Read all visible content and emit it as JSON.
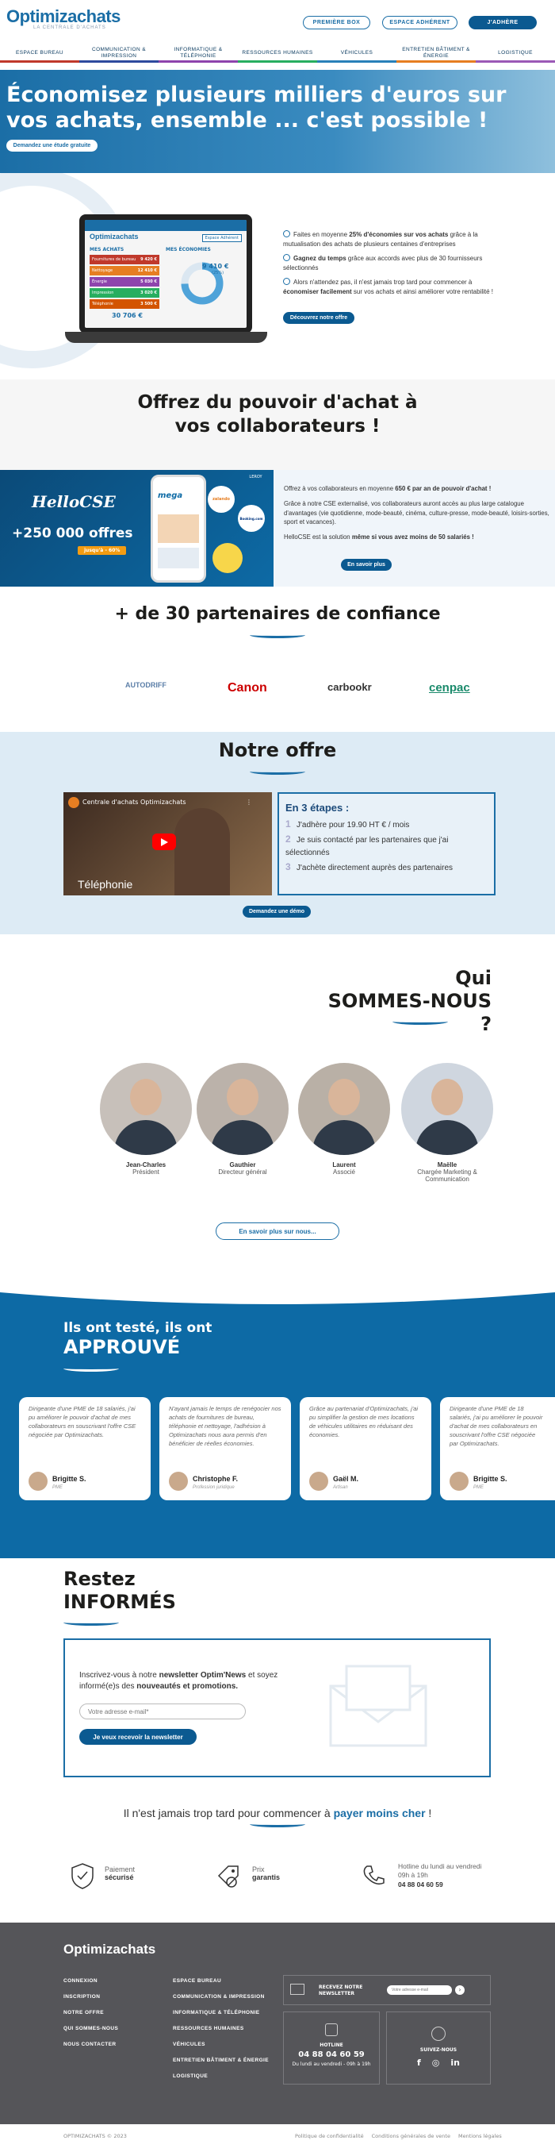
{
  "header": {
    "logo": "Optimizachats",
    "tagline": "LA CENTRALE D'ACHATS",
    "btn_demo": "PREMIÈRE BOX",
    "btn_login": "ESPACE ADHÉRENT",
    "btn_join": "J'ADHÈRE",
    "nav": [
      {
        "label": "ESPACE BUREAU",
        "color": "#c0392b"
      },
      {
        "label": "COMMUNICATION & IMPRESSION",
        "color": "#2e4a9e"
      },
      {
        "label": "INFORMATIQUE & TÉLÉPHONIE",
        "color": "#8e44ad"
      },
      {
        "label": "RESSOURCES HUMAINES",
        "color": "#27ae60"
      },
      {
        "label": "VÉHICULES",
        "color": "#2980b9"
      },
      {
        "label": "ENTRETIEN BÂTIMENT & ÉNERGIE",
        "color": "#e67e22"
      },
      {
        "label": "LOGISTIQUE",
        "color": "#9b59b6"
      }
    ]
  },
  "hero": {
    "title": "Économisez plusieurs milliers d'euros sur vos achats, ensemble ... c'est possible !",
    "cta": "Demandez une étude gratuite"
  },
  "intro": {
    "screen_title": "Optimizachats",
    "screen_tag": "Espace Adhérent",
    "screen_left_title": "MES ACHATS",
    "screen_right_title": "MES ÉCONOMIES",
    "screen_rows": [
      {
        "label": "Fournitures de bureau",
        "value": "9 420 €",
        "color": "#c0392b"
      },
      {
        "label": "Nettoyage",
        "value": "12 410 €",
        "color": "#e67e22"
      },
      {
        "label": "Énergie",
        "value": "5 030 €",
        "color": "#8e44ad"
      },
      {
        "label": "Impression",
        "value": "3 020 €",
        "color": "#27ae60"
      },
      {
        "label": "Téléphonie",
        "value": "3 500 €",
        "color": "#d35400"
      }
    ],
    "screen_saving": "9 410 €",
    "screen_saving_pct": "(25%)",
    "screen_total": "30 706 €",
    "points": [
      {
        "pre": "Faites en moyenne ",
        "bold": "25% d'économies sur vos achats",
        "post": " grâce à la mutualisation des achats de plusieurs centaines d'entreprises"
      },
      {
        "pre": "",
        "bold": "Gagnez du temps",
        "post": " grâce aux accords avec plus de 30 fournisseurs sélectionnés"
      },
      {
        "pre": "Alors n'attendez pas, il n'est jamais trop tard pour commencer à ",
        "bold": "économiser facilement",
        "post": " sur vos achats et ainsi améliorer votre rentabilité !"
      }
    ],
    "cta": "Découvrez notre offre"
  },
  "cse": {
    "title": "Offrez du pouvoir d'achat à vos collaborateurs !",
    "brand": "HelloCSE",
    "big": "+250 000 offres",
    "promo": "jusqu'à - 60%",
    "p1_pre": "Offrez à vos collaborateurs en moyenne ",
    "p1_bold": "650 € par an de pouvoir d'achat !",
    "p2": "Grâce à notre CSE externalisé, vos collaborateurs auront accès au plus large catalogue d'avantages (vie quotidienne, mode-beauté, cinéma, culture-presse, mode-beauté, loisirs-sorties, sport et vacances).",
    "p3_pre": "HelloCSE est la solution ",
    "p3_bold": "même si vous avez moins de 50 salariés !",
    "cta": "En savoir plus",
    "phone_brand": "mega",
    "tag1": "LEROY",
    "tag2": "Booking.com",
    "tag3": "zalando"
  },
  "partners": {
    "title": "+ de 30 partenaires de confiance",
    "items": [
      {
        "name": "AUTODRIFF",
        "color": "#5c7fa8"
      },
      {
        "name": "Canon",
        "color": "#cc0000"
      },
      {
        "name": "carbookr",
        "color": "#333333"
      },
      {
        "name": "cenpac",
        "color": "#1a8a6b"
      }
    ]
  },
  "offer": {
    "title": "Notre offre",
    "video_title": "Centrale d'achats Optimizachats",
    "video_caption": "Téléphonie",
    "steps_title": "En 3 étapes :",
    "steps": [
      "J'adhère pour 19.90 HT € / mois",
      "Je suis contacté par les partenaires que j'ai sélectionnés",
      "J'achète directement auprès des partenaires"
    ],
    "cta": "Demandez une démo"
  },
  "team": {
    "title1": "Qui",
    "title2": "SOMMES-NOUS ?",
    "people": [
      {
        "name": "Jean-Charles",
        "role": "Président"
      },
      {
        "name": "Gauthier",
        "role": "Directeur général"
      },
      {
        "name": "Laurent",
        "role": "Associé"
      },
      {
        "name": "Maëlle",
        "role": "Chargée Marketing & Communication"
      }
    ],
    "cta": "En savoir plus sur nous..."
  },
  "testimonials": {
    "title1": "Ils ont testé, ils ont",
    "title2": "APPROUVÉ",
    "cards": [
      {
        "text": "Dirigeante d'une PME de 18 salariés, j'ai pu améliorer le pouvoir d'achat de mes collaborateurs en souscrivant l'offre CSE négociée par Optimizachats.",
        "name": "Brigitte S.",
        "role": "PME"
      },
      {
        "text": "N'ayant jamais le temps de renégocier nos achats de fournitures de bureau, téléphonie et nettoyage, l'adhésion à Optimizachats nous aura permis d'en bénéficier de réelles économies.",
        "name": "Christophe F.",
        "role": "Profession juridique"
      },
      {
        "text": "Grâce au partenariat d'Optimizachats, j'ai pu simplifier la gestion de mes locations de véhicules utilitaires en réduisant des économies.",
        "name": "Gaël M.",
        "role": "Artisan"
      },
      {
        "text": "Dirigeante d'une PME de 18 salariés, j'ai pu améliorer le pouvoir d'achat de mes collaborateurs en souscrivant l'offre CSE négociée par Optimizachats.",
        "name": "Brigitte S.",
        "role": "PME"
      }
    ]
  },
  "newsletter": {
    "title1": "Restez",
    "title2": "INFORMÉS",
    "text_pre": "Inscrivez-vous à notre ",
    "text_bold": "newsletter Optim'News",
    "text_mid": " et soyez informé(e)s des ",
    "text_bold2": "nouveautés et promotions.",
    "placeholder": "Votre adresse e-mail*",
    "cta": "Je veux recevoir la newsletter"
  },
  "late": {
    "text": "Il n'est jamais trop tard pour commencer à ",
    "bold": "payer moins cher",
    "end": " !"
  },
  "assurances": [
    {
      "icon": "shield-check-icon",
      "l1": "Paiement",
      "l2": "sécurisé"
    },
    {
      "icon": "price-tag-icon",
      "l1": "Prix",
      "l2": "garantis"
    },
    {
      "icon": "phone-icon",
      "l1": "Hotline du lundi au vendredi",
      "l2": "09h à 19h",
      "l3": "04 88 04 60 59"
    }
  ],
  "footer": {
    "logo": "Optimizachats",
    "col1": [
      "CONNEXION",
      "INSCRIPTION",
      "NOTRE OFFRE",
      "QUI SOMMES-NOUS",
      "NOUS CONTACTER"
    ],
    "col2": [
      "ESPACE BUREAU",
      "COMMUNICATION & IMPRESSION",
      "INFORMATIQUE & TÉLÉPHONIE",
      "RESSOURCES HUMAINES",
      "VÉHICULES",
      "ENTRETIEN BÂTIMENT & ÉNERGIE",
      "LOGISTIQUE"
    ],
    "news_label": "RECEVEZ NOTRE NEWSLETTER",
    "news_placeholder": "Votre adresse e-mail",
    "hotline_label": "HOTLINE",
    "hotline_number": "04 88 04 60 59",
    "hotline_hours": "Du lundi au vendredi - 09h à 19h",
    "follow_label": "SUIVEZ-NOUS",
    "copyright": "OPTIMIZACHATS © 2023",
    "legal": [
      "Politique de confidentialité",
      "Conditions générales de vente",
      "Mentions légales"
    ]
  }
}
